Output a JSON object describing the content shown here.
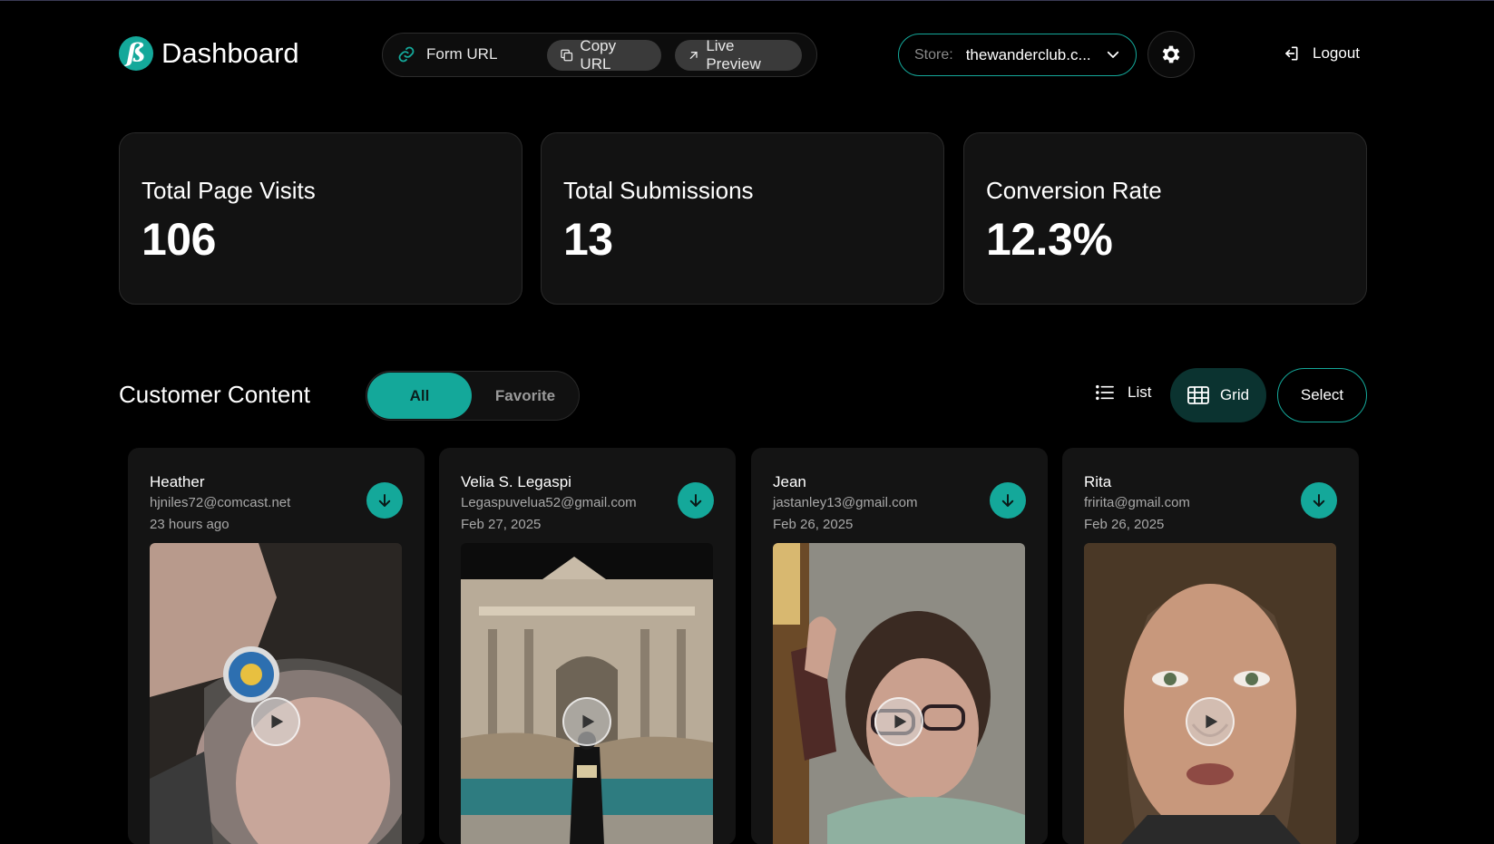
{
  "header": {
    "app_title": "Dashboard",
    "logo_letter": "ß",
    "form_url_label": "Form URL",
    "copy_url_label": "Copy URL",
    "live_preview_label": "Live Preview",
    "store_label": "Store:",
    "store_value": "thewanderclub.c...",
    "logout_label": "Logout"
  },
  "stats": [
    {
      "label": "Total Page Visits",
      "value": "106"
    },
    {
      "label": "Total Submissions",
      "value": "13"
    },
    {
      "label": "Conversion Rate",
      "value": "12.3%"
    }
  ],
  "content": {
    "title": "Customer Content",
    "tabs": {
      "all": "All",
      "favorite": "Favorite"
    },
    "view": {
      "list": "List",
      "grid": "Grid"
    },
    "select_label": "Select",
    "cards": [
      {
        "name": "Heather",
        "email": "hjniles72@comcast.net",
        "date": "23 hours ago"
      },
      {
        "name": "Velia S. Legaspi",
        "email": "Legaspuvelua52@gmail.com",
        "date": "Feb 27, 2025"
      },
      {
        "name": "Jean",
        "email": "jastanley13@gmail.com",
        "date": "Feb 26, 2025"
      },
      {
        "name": "Rita",
        "email": "fririta@gmail.com",
        "date": "Feb 26, 2025"
      }
    ]
  },
  "colors": {
    "accent": "#14a89a",
    "background": "#000000",
    "card": "#121212"
  }
}
